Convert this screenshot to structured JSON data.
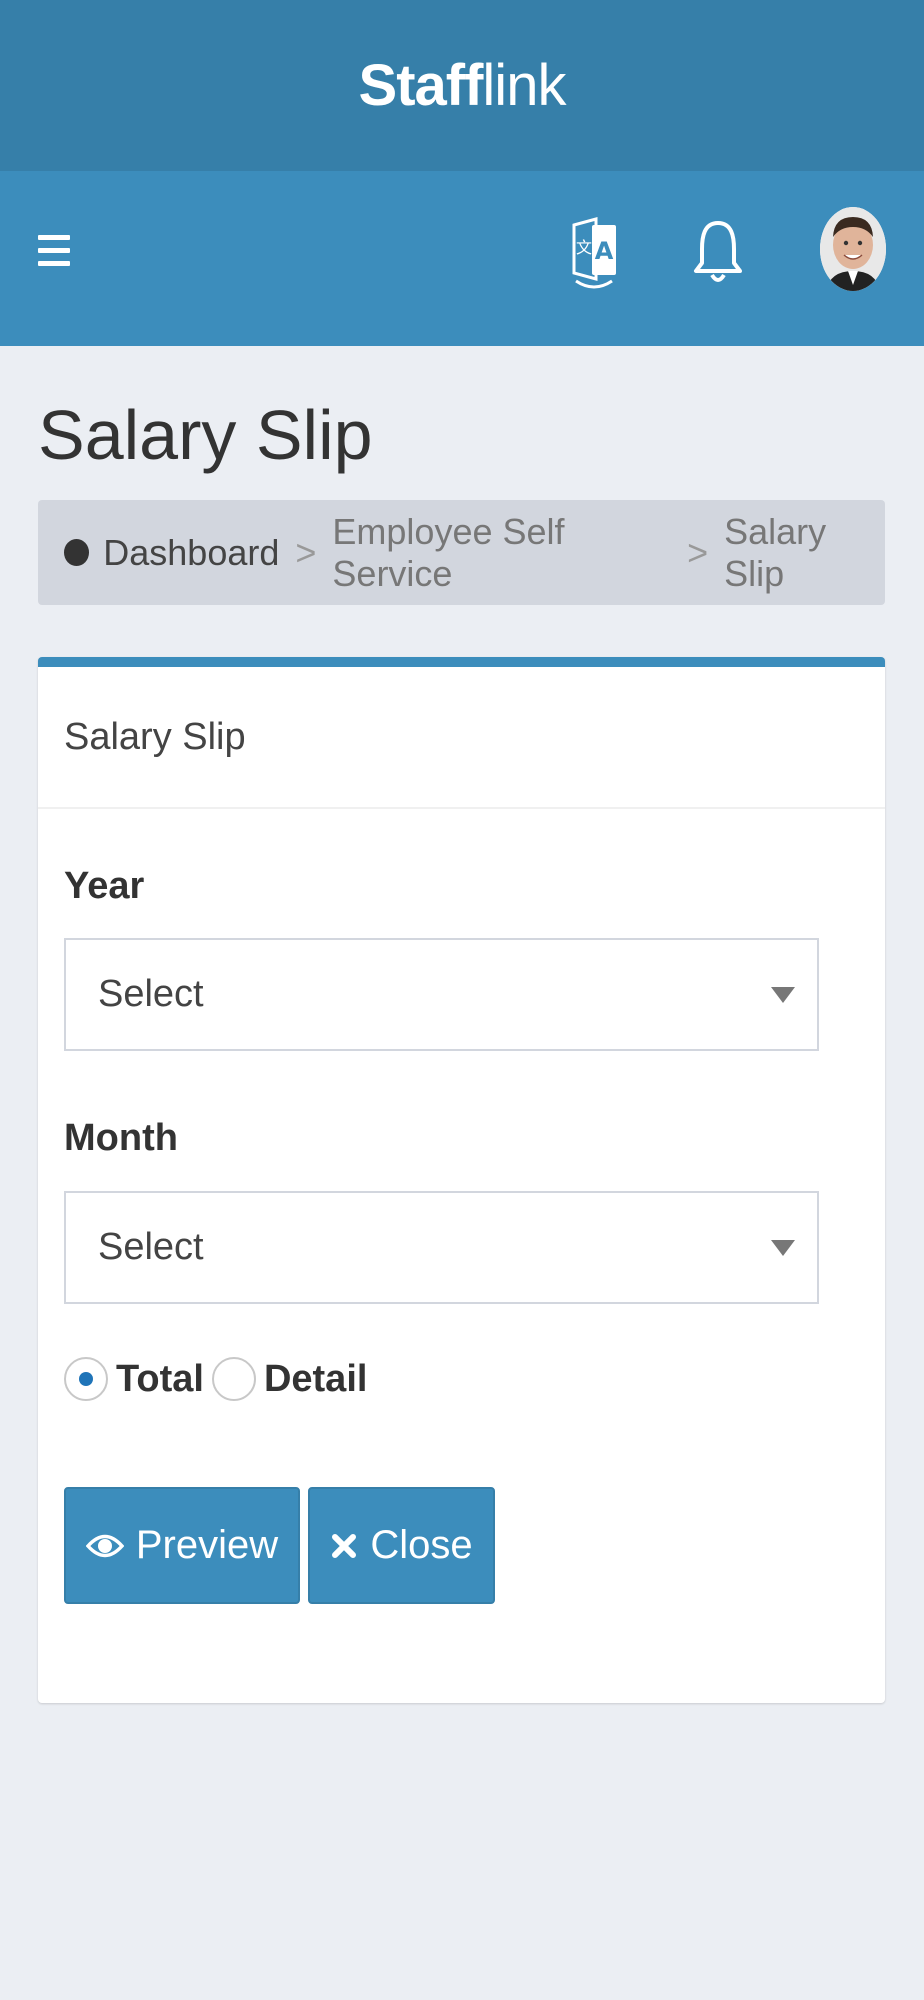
{
  "header": {
    "brand_bold": "Staff",
    "brand_light": "link"
  },
  "navbar": {
    "icons": [
      "menu-icon",
      "translate-icon",
      "bell-icon",
      "user-avatar"
    ]
  },
  "page": {
    "title": "Salary Slip"
  },
  "breadcrumb": {
    "items": [
      "Dashboard",
      "Employee Self Service",
      "Salary Slip"
    ],
    "separator": ">"
  },
  "card": {
    "header": "Salary Slip",
    "accent_color": "#3c8dbc",
    "year": {
      "label": "Year",
      "value": "Select"
    },
    "month": {
      "label": "Month",
      "value": "Select"
    },
    "report_type": {
      "options": [
        "Total",
        "Detail"
      ],
      "selected": "Total"
    },
    "buttons": {
      "preview": "Preview",
      "close": "Close"
    }
  },
  "colors": {
    "brand_bar": "#367fa9",
    "navbar": "#3c8dbc",
    "background": "#ebeef3",
    "button": "#3c8dbc"
  }
}
